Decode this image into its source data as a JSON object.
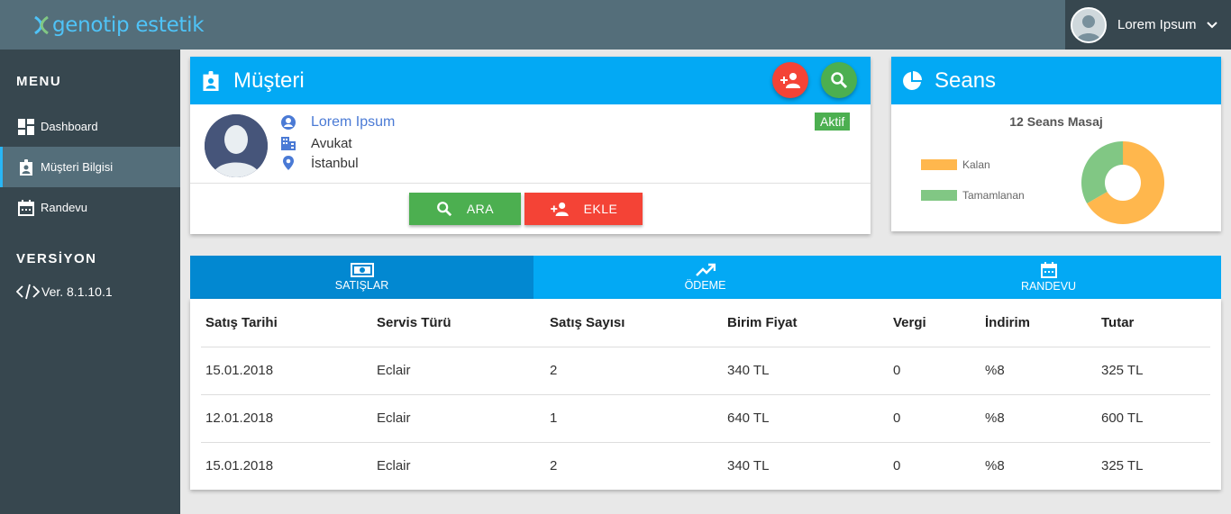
{
  "header": {
    "logo_text": "genotip estetik",
    "user_name": "Lorem Ipsum"
  },
  "sidebar": {
    "menu_title": "MENU",
    "items": [
      {
        "label": "Dashboard",
        "icon": "dashboard-icon"
      },
      {
        "label": "Müşteri Bilgisi",
        "icon": "badge-icon",
        "active": true
      },
      {
        "label": "Randevu",
        "icon": "calendar-icon"
      }
    ],
    "version_title": "VERSİYON",
    "version": "Ver. 8.1.10.1"
  },
  "customer": {
    "title": "Müşteri",
    "name": "Lorem Ipsum",
    "occupation": "Avukat",
    "city": "İstanbul",
    "status": "Aktif",
    "search_label": "ARA",
    "add_label": "EKLE"
  },
  "sessions": {
    "title": "Seans",
    "chart_title": "12 Seans Masaj"
  },
  "chart_data": {
    "type": "pie",
    "title": "12 Seans Masaj",
    "donut": true,
    "legend": "left",
    "slices": [
      {
        "label": "Kalan",
        "value": 8,
        "color": "#ffb74d"
      },
      {
        "label": "Tamamlanan",
        "value": 4,
        "color": "#81c784"
      }
    ]
  },
  "tabs": [
    {
      "label": "SATIŞLAR",
      "icon": "money-icon",
      "active": true
    },
    {
      "label": "ÖDEME",
      "icon": "trending-up-icon"
    },
    {
      "label": "RANDEVU",
      "icon": "calendar-icon"
    }
  ],
  "sales_table": {
    "columns": [
      "Satış Tarihi",
      "Servis Türü",
      "Satış Sayısı",
      "Birim Fiyat",
      "Vergi",
      "İndirim",
      "Tutar"
    ],
    "rows": [
      [
        "15.01.2018",
        "Eclair",
        "2",
        "340 TL",
        "0",
        "%8",
        "325 TL"
      ],
      [
        "12.01.2018",
        "Eclair",
        "1",
        "640 TL",
        "0",
        "%8",
        "600 TL"
      ],
      [
        "15.01.2018",
        "Eclair",
        "2",
        "340 TL",
        "0",
        "%8",
        "325 TL"
      ]
    ]
  },
  "colors": {
    "primary": "#03a9f4",
    "primary_dark": "#0288d1",
    "success": "#4caf50",
    "danger": "#f44336",
    "sidebar": "#37474f",
    "topbar": "#546e7a"
  }
}
